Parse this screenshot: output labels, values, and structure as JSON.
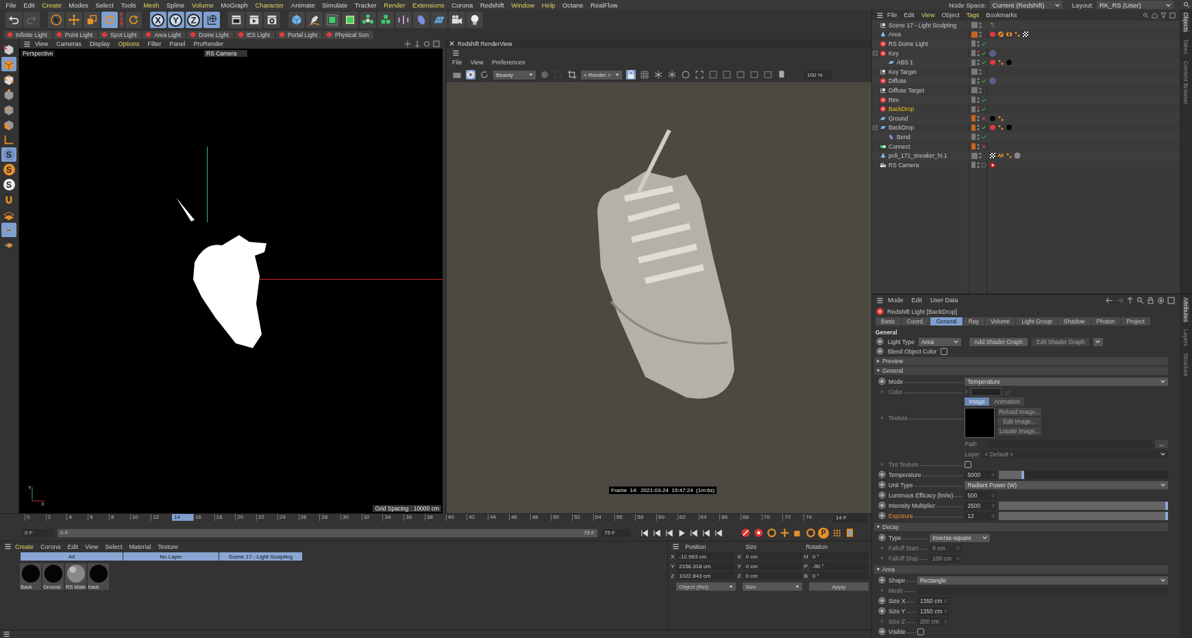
{
  "menu_bar": {
    "items": [
      {
        "label": "File",
        "highlighted": false
      },
      {
        "label": "Edit",
        "highlighted": false
      },
      {
        "label": "Create",
        "highlighted": true
      },
      {
        "label": "Modes",
        "highlighted": false
      },
      {
        "label": "Select",
        "highlighted": false
      },
      {
        "label": "Tools",
        "highlighted": false
      },
      {
        "label": "Mesh",
        "highlighted": true
      },
      {
        "label": "Spline",
        "highlighted": false
      },
      {
        "label": "Volume",
        "highlighted": true
      },
      {
        "label": "MoGraph",
        "highlighted": false
      },
      {
        "label": "Character",
        "highlighted": true
      },
      {
        "label": "Animate",
        "highlighted": false
      },
      {
        "label": "Simulate",
        "highlighted": false
      },
      {
        "label": "Tracker",
        "highlighted": false
      },
      {
        "label": "Render",
        "highlighted": true
      },
      {
        "label": "Extensions",
        "highlighted": true
      },
      {
        "label": "Corona",
        "highlighted": false
      },
      {
        "label": "Redshift",
        "highlighted": false
      },
      {
        "label": "Window",
        "highlighted": true
      },
      {
        "label": "Help",
        "highlighted": true
      },
      {
        "label": "Octane",
        "highlighted": false
      },
      {
        "label": "RealFlow",
        "highlighted": false
      }
    ],
    "node_space": {
      "label": "Node Space:",
      "value": "Current (Redshift)"
    },
    "layout": {
      "label": "Layout:",
      "value": "RK_RS (User)"
    }
  },
  "toolbar": [
    {
      "kind": "undo",
      "selected": false
    },
    {
      "kind": "redo",
      "selected": false
    },
    {
      "kind": "select",
      "selected": false
    },
    {
      "kind": "move",
      "selected": false
    },
    {
      "kind": "scale",
      "selected": false
    },
    {
      "kind": "rotate",
      "selected": true
    },
    {
      "kind": "psr",
      "label": "PSR",
      "selected": false
    },
    {
      "kind": "recent",
      "selected": false
    },
    {
      "kind": "axis",
      "label": "X",
      "selected": true
    },
    {
      "kind": "axis",
      "label": "Y",
      "selected": true
    },
    {
      "kind": "axis",
      "label": "Z",
      "selected": true
    },
    {
      "kind": "world",
      "selected": true
    },
    {
      "kind": "render-view",
      "selected": false
    },
    {
      "kind": "render",
      "selected": false
    },
    {
      "kind": "render-settings",
      "selected": false
    },
    {
      "kind": "cube",
      "selected": false
    },
    {
      "kind": "pen",
      "selected": false
    },
    {
      "kind": "subdivide",
      "selected": false
    },
    {
      "kind": "extrude",
      "selected": false
    },
    {
      "kind": "cloner",
      "selected": false
    },
    {
      "kind": "array",
      "selected": false
    },
    {
      "kind": "deformer",
      "selected": false
    },
    {
      "kind": "ellipsoid",
      "selected": false
    },
    {
      "kind": "floor",
      "selected": false
    },
    {
      "kind": "camera",
      "selected": false
    },
    {
      "kind": "light",
      "selected": false
    }
  ],
  "light_presets": [
    "Infinite Light",
    "Point Light",
    "Spot Light",
    "Area Light",
    "Dome Light",
    "IES Light",
    "Portal Light",
    "Physical Sun"
  ],
  "left_tools": [
    {
      "kind": "make-editable",
      "selected": false
    },
    {
      "kind": "model",
      "selected": true
    },
    {
      "kind": "texture",
      "selected": false
    },
    {
      "kind": "points",
      "selected": false
    },
    {
      "kind": "edges",
      "selected": false
    },
    {
      "kind": "polygons",
      "selected": false
    },
    {
      "kind": "axis",
      "selected": false
    },
    {
      "kind": "snap",
      "label": "S",
      "selected": true
    },
    {
      "kind": "snap-orange",
      "label": "S",
      "selected": false
    },
    {
      "kind": "snap-white",
      "label": "S",
      "selected": false
    },
    {
      "kind": "magnet",
      "selected": false
    },
    {
      "kind": "workplane",
      "selected": false
    },
    {
      "kind": "grid",
      "selected": true
    },
    {
      "kind": "lock",
      "selected": false
    }
  ],
  "viewport": {
    "menu": [
      {
        "label": "View",
        "highlighted": false
      },
      {
        "label": "Cameras",
        "highlighted": false
      },
      {
        "label": "Display",
        "highlighted": false
      },
      {
        "label": "Options",
        "highlighted": true
      },
      {
        "label": "Filter",
        "highlighted": false
      },
      {
        "label": "Panel",
        "highlighted": false
      },
      {
        "label": "ProRender",
        "highlighted": false
      }
    ],
    "view_name": "Perspective",
    "camera": "RS Camera",
    "grid_spacing": "Grid Spacing : 10000 cm",
    "axis_labels": [
      "Y",
      "X"
    ]
  },
  "render_view": {
    "title": "Redshift RenderView",
    "menu": [
      "File",
      "View",
      "Preferences"
    ],
    "aov": "Beauty",
    "render_mode": "< Render >",
    "zoom": "100 %",
    "caption": "Frame  14:  2021-03-24  15:47:24  (1m:6s)"
  },
  "timeline": {
    "ticks": [
      {
        "label": "0",
        "selected": false
      },
      {
        "label": "2",
        "selected": false
      },
      {
        "label": "4",
        "selected": false
      },
      {
        "label": "6",
        "selected": false
      },
      {
        "label": "8",
        "selected": false
      },
      {
        "label": "10",
        "selected": false
      },
      {
        "label": "12",
        "selected": false
      },
      {
        "label": "14",
        "selected": true
      },
      {
        "label": "16",
        "selected": false
      },
      {
        "label": "18",
        "selected": false
      },
      {
        "label": "20",
        "selected": false
      },
      {
        "label": "22",
        "selected": false
      },
      {
        "label": "24",
        "selected": false
      },
      {
        "label": "26",
        "selected": false
      },
      {
        "label": "28",
        "selected": false
      },
      {
        "label": "30",
        "selected": false
      },
      {
        "label": "32",
        "selected": false
      },
      {
        "label": "34",
        "selected": false
      },
      {
        "label": "36",
        "selected": false
      },
      {
        "label": "38",
        "selected": false
      },
      {
        "label": "40",
        "selected": false
      },
      {
        "label": "42",
        "selected": false
      },
      {
        "label": "44",
        "selected": false
      },
      {
        "label": "46",
        "selected": false
      },
      {
        "label": "48",
        "selected": false
      },
      {
        "label": "50",
        "selected": false
      },
      {
        "label": "52",
        "selected": false
      },
      {
        "label": "54",
        "selected": false
      },
      {
        "label": "56",
        "selected": false
      },
      {
        "label": "58",
        "selected": false
      },
      {
        "label": "60",
        "selected": false
      },
      {
        "label": "62",
        "selected": false
      },
      {
        "label": "64",
        "selected": false
      },
      {
        "label": "66",
        "selected": false
      },
      {
        "label": "68",
        "selected": false
      },
      {
        "label": "70",
        "selected": false
      },
      {
        "label": "72",
        "selected": false
      },
      {
        "label": "74",
        "selected": false
      }
    ],
    "current_frame": "14 F",
    "start": "0 F",
    "range_start": "0 F",
    "range_end": "75 F",
    "level": 1,
    "end": "75 F",
    "key_tools": [
      {
        "kind": "record"
      },
      {
        "kind": "autokey"
      },
      {
        "kind": "key-set"
      },
      {
        "kind": "key-position"
      },
      {
        "kind": "key-scale"
      },
      {
        "kind": "key-rotation"
      },
      {
        "kind": "key-pla",
        "label": "P"
      },
      {
        "kind": "key-grid"
      },
      {
        "kind": "film"
      }
    ]
  },
  "materials": {
    "menu": [
      {
        "label": "Create",
        "highlighted": true
      },
      {
        "label": "Corona",
        "highlighted": false
      },
      {
        "label": "Edit",
        "highlighted": false
      },
      {
        "label": "View",
        "highlighted": false
      },
      {
        "label": "Select",
        "highlighted": false
      },
      {
        "label": "Material",
        "highlighted": false
      },
      {
        "label": "Texture",
        "highlighted": false
      }
    ],
    "filters": [
      "All",
      "No Layer",
      "Scene 17 - Light Sculpting"
    ],
    "items": [
      {
        "name": "Back",
        "kind": "black"
      },
      {
        "name": "Ground",
        "kind": "black"
      },
      {
        "name": "RS Mate",
        "kind": "gray"
      },
      {
        "name": "back",
        "kind": "black"
      }
    ]
  },
  "coordinates": {
    "headers": [
      "Position",
      "Size",
      "Rotation"
    ],
    "rows": [
      [
        {
          "axis": "X",
          "value": "-12.963 cm"
        },
        {
          "axis": "X",
          "value": "0 cm"
        },
        {
          "axis": "H",
          "value": "0 °"
        }
      ],
      [
        {
          "axis": "Y",
          "value": "2156.318 cm"
        },
        {
          "axis": "Y",
          "value": "0 cm"
        },
        {
          "axis": "P",
          "value": "-90 °"
        }
      ],
      [
        {
          "axis": "Z",
          "value": "1022.843 cm"
        },
        {
          "axis": "Z",
          "value": "0 cm"
        },
        {
          "axis": "B",
          "value": "0 °"
        }
      ]
    ],
    "modes": [
      "Object (Rel)",
      "Size"
    ],
    "apply": "Apply"
  },
  "objects": {
    "menu": [
      {
        "label": "File",
        "highlighted": false
      },
      {
        "label": "Edit",
        "highlighted": false
      },
      {
        "label": "View",
        "highlighted": true
      },
      {
        "label": "Object",
        "highlighted": false
      },
      {
        "label": "Tags",
        "highlighted": true
      },
      {
        "label": "Bookmarks",
        "highlighted": false
      }
    ],
    "items": [
      {
        "name": "Scene 17 - Light Sculpting",
        "kind": "null",
        "color": "#7a7a7a",
        "hidden_in_editor": false,
        "selected": false,
        "tags": [
          {
            "kind": "display"
          }
        ]
      },
      {
        "name": "Area",
        "kind": "poly",
        "color": "#c8641e",
        "hidden_in_editor": false,
        "selected": false,
        "tags": [
          {
            "kind": "rs-object"
          },
          {
            "kind": "phong"
          },
          {
            "kind": "eye"
          },
          {
            "kind": "dots"
          },
          {
            "kind": "checker"
          }
        ]
      },
      {
        "name": "RS Dome Light",
        "kind": "light",
        "color": "#7a7a7a",
        "hidden_in_editor": false,
        "enabled": true,
        "selected": false
      },
      {
        "name": "Key",
        "kind": "light",
        "color": "#7a7a7a",
        "hidden_in_editor": true,
        "enabled": true,
        "selected": false,
        "tags": [
          {
            "kind": "target"
          }
        ],
        "children": [
          {
            "name": "ABS 1",
            "kind": "plane",
            "color": "#7a7a7a",
            "hidden_in_editor": false,
            "enabled": true,
            "selected": false,
            "tags": [
              {
                "kind": "rs-object"
              },
              {
                "kind": "dots"
              },
              {
                "kind": "black-material"
              }
            ]
          }
        ]
      },
      {
        "name": "Key Target",
        "kind": "null",
        "color": "#7a7a7a",
        "hidden_in_editor": false,
        "selected": false
      },
      {
        "name": "Diffuse",
        "kind": "light",
        "color": "#7a7a7a",
        "hidden_in_editor": false,
        "enabled": true,
        "selected": false,
        "tags": [
          {
            "kind": "target"
          }
        ]
      },
      {
        "name": "Diffuse Target",
        "kind": "null",
        "color": "#7a7a7a",
        "hidden_in_editor": false,
        "selected": false
      },
      {
        "name": "Rim",
        "kind": "light",
        "color": "#7a7a7a",
        "hidden_in_editor": false,
        "enabled": true,
        "selected": false
      },
      {
        "name": "BackDrop",
        "kind": "light",
        "color": "#7a7a7a",
        "hidden_in_editor": true,
        "enabled": true,
        "selected": true
      },
      {
        "name": "Ground",
        "kind": "plane",
        "color": "#c8641e",
        "hidden_in_editor": false,
        "enabled": false,
        "selected": false,
        "tags": [
          {
            "kind": "black-material"
          },
          {
            "kind": "dots"
          }
        ]
      },
      {
        "name": "BackDrop",
        "kind": "plane",
        "color": "#c8641e",
        "hidden_in_editor": false,
        "enabled": true,
        "selected": false,
        "tags": [
          {
            "kind": "rs-object"
          },
          {
            "kind": "dots"
          },
          {
            "kind": "black-material"
          }
        ],
        "children": [
          {
            "name": "Bend",
            "kind": "bend",
            "color": "#7a7a7a",
            "hidden_in_editor": false,
            "enabled": true,
            "selected": false
          }
        ]
      },
      {
        "name": "Connect",
        "kind": "connect",
        "color": "#c8641e",
        "hidden_in_editor": false,
        "enabled": false,
        "selected": false
      },
      {
        "name": "poli_171_sneaker_hi.1",
        "kind": "poly",
        "color": "#7a7a7a",
        "hidden_in_editor": false,
        "selected": false,
        "tags": [
          {
            "kind": "checker"
          },
          {
            "kind": "uvw"
          },
          {
            "kind": "dots"
          },
          {
            "kind": "gray-material"
          }
        ]
      },
      {
        "name": "RS Camera",
        "kind": "camera",
        "color": "#7a7a7a",
        "hidden_in_editor": false,
        "selected": false,
        "tags": [
          {
            "kind": "rs-camera"
          }
        ]
      }
    ],
    "side_tabs": [
      {
        "label": "Objects",
        "selected": true
      },
      {
        "label": "Takes",
        "selected": false
      },
      {
        "label": "Content Browser",
        "selected": false
      }
    ]
  },
  "attributes": {
    "menu": [
      "Mode",
      "Edit",
      "User Data"
    ],
    "title": "Redshift Light [BackDrop]",
    "tabs": [
      {
        "label": "Basic",
        "selected": false
      },
      {
        "label": "Coord.",
        "selected": false
      },
      {
        "label": "General",
        "selected": true
      },
      {
        "label": "Ray",
        "selected": false
      },
      {
        "label": "Volume",
        "selected": false
      },
      {
        "label": "Light Group",
        "selected": false
      },
      {
        "label": "Shadow",
        "selected": false
      },
      {
        "label": "Photon",
        "selected": false
      },
      {
        "label": "Project",
        "selected": false
      }
    ],
    "section_title": "General",
    "light_type": {
      "label": "Light Type",
      "value": "Area"
    },
    "shader_buttons": [
      {
        "label": "Add Shader Graph",
        "disabled": false
      },
      {
        "label": "Edit Shader Graph",
        "disabled": true
      }
    ],
    "blend_object_color": {
      "label": "Blend Object Color",
      "checked": false
    },
    "groups": [
      {
        "title": "Preview",
        "expanded": false
      },
      {
        "title": "General",
        "expanded": true,
        "rows": [
          {
            "kind": "dropdown",
            "label": "Mode",
            "value": "Temperature",
            "disabled": false,
            "highlighted": false
          },
          {
            "kind": "color",
            "label": "Color",
            "disabled": true,
            "highlighted": false
          },
          {
            "kind": "texture",
            "label": "Texture",
            "disabled": true,
            "highlighted": false,
            "modes": [
              {
                "label": "Image",
                "selected": true
              },
              {
                "label": "Animation",
                "selected": false
              }
            ],
            "buttons": [
              "Reload Image...",
              "Edit Image...",
              "Locate Image..."
            ]
          },
          {
            "kind": "path",
            "label": "Path",
            "button": "...",
            "disabled": true,
            "highlighted": false
          },
          {
            "kind": "layer",
            "label": "Layer",
            "value": "< Default >",
            "disabled": true,
            "highlighted": false
          },
          {
            "kind": "checkbox",
            "label": "Tint Texture",
            "checked": false,
            "disabled": true,
            "highlighted": false
          },
          {
            "kind": "slider",
            "label": "Temperature",
            "value": "5000",
            "level": 0.15,
            "disabled": false,
            "highlighted": false
          },
          {
            "kind": "dropdown",
            "label": "Unit Type",
            "value": "Radiant Power (W)",
            "disabled": false,
            "highlighted": false
          },
          {
            "kind": "number",
            "label": "Luminous Efficacy (lm/w)",
            "value": "500",
            "disabled": false,
            "highlighted": false
          },
          {
            "kind": "slider",
            "label": "Intensity Multiplier",
            "value": "2500",
            "level": 1,
            "disabled": false,
            "highlighted": false
          },
          {
            "kind": "slider",
            "label": "Exposure",
            "value": "12",
            "level": 1,
            "disabled": false,
            "highlighted": true
          }
        ]
      },
      {
        "title": "Decay",
        "expanded": true,
        "rows": [
          {
            "kind": "dropdown-short",
            "label": "Type",
            "value": "Inverse-square",
            "disabled": false,
            "highlighted": false
          },
          {
            "kind": "number",
            "label": "Falloff Start",
            "value": "0 cm",
            "disabled": true,
            "highlighted": false
          },
          {
            "kind": "number",
            "label": "Falloff Stop",
            "value": "100 cm",
            "disabled": true,
            "highlighted": false
          }
        ]
      },
      {
        "title": "Area",
        "expanded": true,
        "rows": [
          {
            "kind": "dropdown",
            "label": "Shape",
            "value": "Rectangle",
            "disabled": false,
            "highlighted": false
          },
          {
            "kind": "mesh",
            "label": "Mesh",
            "disabled": true,
            "highlighted": false
          },
          {
            "kind": "number",
            "label": "Size X",
            "value": "1350 cm",
            "disabled": false,
            "highlighted": false
          },
          {
            "kind": "number",
            "label": "Size Y",
            "value": "1350 cm",
            "disabled": false,
            "highlighted": false
          },
          {
            "kind": "number",
            "label": "Size Z",
            "value": "200 cm",
            "disabled": true,
            "highlighted": false
          },
          {
            "kind": "checkbox",
            "label": "Visible",
            "checked": false,
            "disabled": false,
            "highlighted": false
          }
        ]
      }
    ],
    "side_tabs": [
      {
        "label": "Attributes",
        "selected": true
      },
      {
        "label": "Layers",
        "selected": false
      },
      {
        "label": "Structure",
        "selected": false
      }
    ]
  }
}
